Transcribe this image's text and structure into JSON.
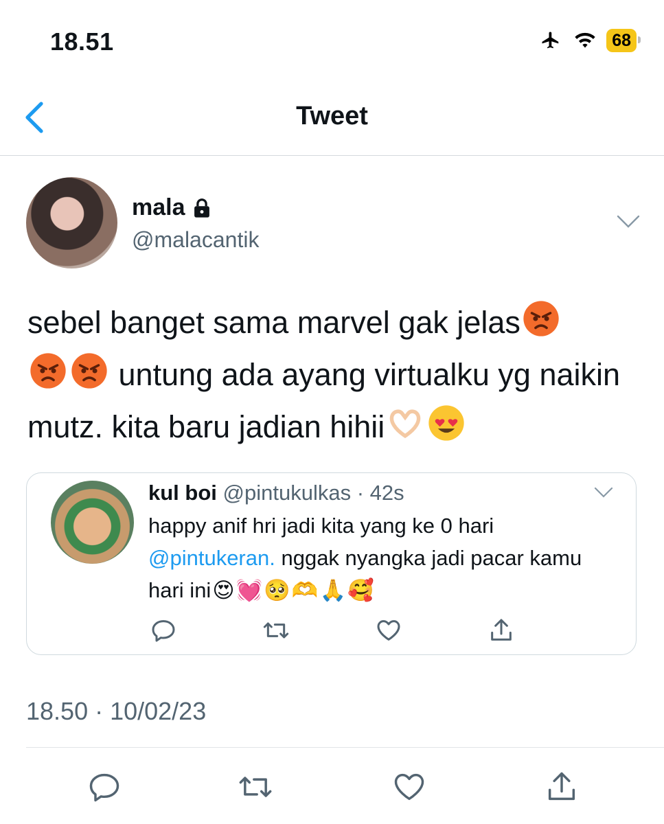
{
  "status_bar": {
    "time": "18.51",
    "battery": "68",
    "icons": [
      "airplane-icon",
      "wifi-icon",
      "battery-icon"
    ]
  },
  "nav": {
    "title": "Tweet",
    "back_icon": "chevron-left-icon"
  },
  "tweet": {
    "author_name": "mala",
    "author_handle": "@malacantik",
    "locked": true,
    "text_part1": "sebel banget sama marvel gak jelas",
    "text_part2": "untung ada ayang virtualku yg naikin mutz. kita baru jadian hihii",
    "timestamp": "18.50 · 10/02/23"
  },
  "quote": {
    "name": "kul boi",
    "meta": "@pintukulkas · 42s",
    "text_part1": "happy anif hri jadi kita yang ke 0 hari",
    "mention": "@pintukeran.",
    "text_part2": " nggak nyangka jadi pacar kamu hari ini",
    "emojis": [
      "😍",
      "💓",
      "🥺",
      "🫶",
      "🙏",
      "🥰"
    ]
  },
  "actions": [
    "reply-icon",
    "retweet-icon",
    "like-icon",
    "share-icon"
  ],
  "colors": {
    "accent": "#1d9bf0",
    "secondary_text": "#536471",
    "battery": "#f5c518"
  }
}
